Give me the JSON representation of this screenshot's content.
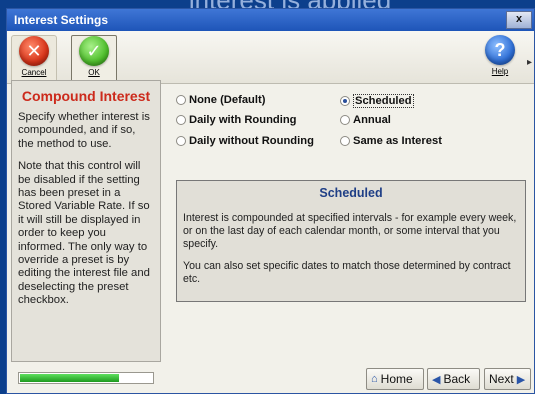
{
  "background_strip_text": "interest is applied",
  "window": {
    "title": "Interest Settings",
    "close_glyph": "x"
  },
  "toolbar": {
    "cancel_label": "Cancel",
    "ok_label": "OK",
    "help_label": "Help",
    "more_glyph": "▸"
  },
  "sidepanel": {
    "title": "Compound Interest",
    "paragraphs": [
      "Specify whether interest is compounded, and if so, the method to use.",
      "Note that this control will be disabled if the setting has been preset in a Stored Variable Rate. If so it will still be displayed in order to keep you informed. The only way to override a preset is by editing the interest file and deselecting the preset checkbox."
    ]
  },
  "options": [
    {
      "label": "None (Default)",
      "checked": false
    },
    {
      "label": "Scheduled",
      "checked": true
    },
    {
      "label": "Daily with Rounding",
      "checked": false
    },
    {
      "label": "Annual",
      "checked": false
    },
    {
      "label": "Daily without Rounding",
      "checked": false
    },
    {
      "label": "Same as Interest",
      "checked": false
    }
  ],
  "infobox": {
    "title": "Scheduled",
    "paragraphs": [
      "Interest is compounded at specified intervals - for example every week, or on the last day of each calendar month, or some interval that you specify.",
      "You can also set specific dates to match those determined by contract etc."
    ]
  },
  "progress": {
    "percent": 75,
    "color": "#2fbf2f"
  },
  "nav": {
    "home_label": "Home",
    "back_label": "Back",
    "next_label": "Next"
  },
  "colors": {
    "title_bar": "#2a61c4",
    "accent_red": "#cc2a1c",
    "info_title": "#1f3f86"
  }
}
